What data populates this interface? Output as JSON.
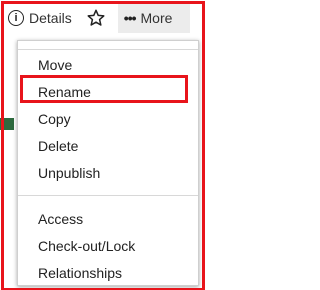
{
  "toolbar": {
    "details_label": "Details",
    "details_icon": "info-circle-icon",
    "star_icon": "star-outline-icon",
    "more_label": "More",
    "more_icon": "more-dots-icon"
  },
  "menu": {
    "group1": [
      "Move",
      "Rename",
      "Copy",
      "Delete",
      "Unpublish"
    ],
    "group2": [
      "Access",
      "Check-out/Lock",
      "Relationships"
    ],
    "highlighted_item": "Rename"
  },
  "colors": {
    "highlight": "#e8141b",
    "toolbar_active_bg": "#ececec",
    "text": "#222222"
  }
}
